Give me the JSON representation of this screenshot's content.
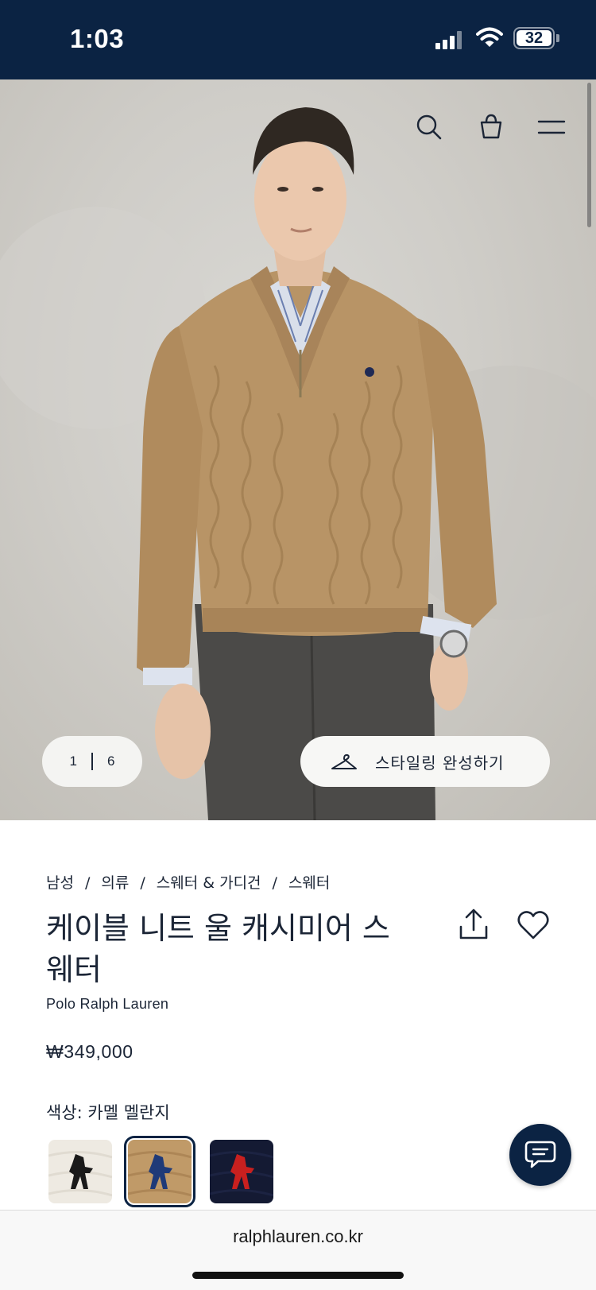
{
  "status_bar": {
    "time": "1:03",
    "battery_level": "32",
    "signal_icon": "cellular-signal-icon",
    "wifi_icon": "wifi-icon"
  },
  "hero": {
    "pager": {
      "current": "1",
      "total": "6"
    },
    "style_button_label": "스타일링 완성하기",
    "style_button_icon": "hanger-icon",
    "header_icons": [
      "search-icon",
      "shopping-bag-icon",
      "menu-icon"
    ]
  },
  "product": {
    "breadcrumb": [
      "남성",
      "의류",
      "스웨터 & 가디건",
      "스웨터"
    ],
    "title": "케이블 니트 울 캐시미어 스웨터",
    "brand": "Polo Ralph Lauren",
    "price": "₩349,000",
    "color_label": "색상: 카멜 멜란지",
    "swatches": [
      {
        "name": "cream",
        "color": "#eeeae2",
        "pony_color": "#1a1a1a",
        "selected": false
      },
      {
        "name": "camel",
        "color": "#c09a68",
        "pony_color": "#1f3a78",
        "selected": true
      },
      {
        "name": "navy",
        "color": "#141a33",
        "pony_color": "#c8201f",
        "selected": false
      }
    ]
  },
  "browser": {
    "url": "ralphlauren.co.kr"
  },
  "colors": {
    "brand_navy": "#0b2343",
    "text": "#1b2536"
  }
}
